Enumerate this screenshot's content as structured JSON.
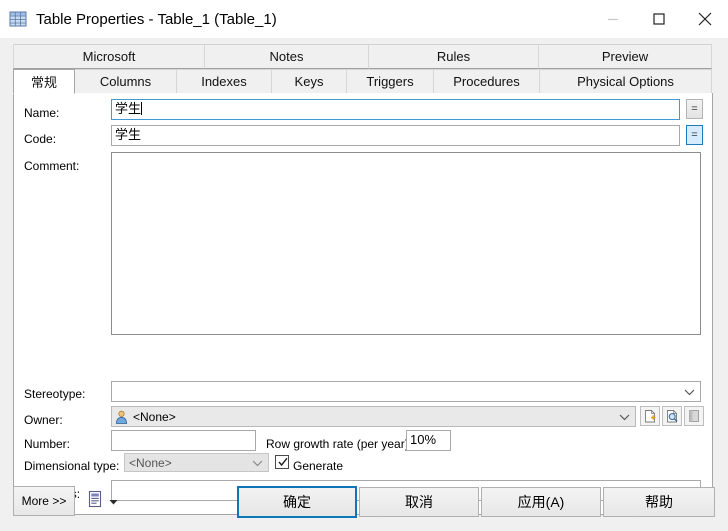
{
  "window": {
    "title": "Table Properties - Table_1 (Table_1)",
    "icon": "table-grid-icon",
    "minimize_label": "Minimize",
    "maximize_label": "Maximize",
    "close_label": "Close"
  },
  "tabs": {
    "row1": [
      {
        "label": "Microsoft",
        "active": false
      },
      {
        "label": "Notes",
        "active": false
      },
      {
        "label": "Rules",
        "active": false
      },
      {
        "label": "Preview",
        "active": false
      }
    ],
    "row2": [
      {
        "label": "常规",
        "active": true
      },
      {
        "label": "Columns",
        "active": false
      },
      {
        "label": "Indexes",
        "active": false
      },
      {
        "label": "Keys",
        "active": false
      },
      {
        "label": "Triggers",
        "active": false
      },
      {
        "label": "Procedures",
        "active": false
      },
      {
        "label": "Physical Options",
        "active": false
      }
    ]
  },
  "form": {
    "name_label": "Name:",
    "name_value": "学生",
    "name_equals_button": "=",
    "code_label": "Code:",
    "code_value": "学生",
    "code_equals_button": "=",
    "comment_label": "Comment:",
    "comment_value": "",
    "stereotype_label": "Stereotype:",
    "stereotype_value": "",
    "owner_label": "Owner:",
    "owner_value": "<None>",
    "number_label": "Number:",
    "number_value": "",
    "row_growth_label": "Row growth rate (per year):",
    "row_growth_value": "10%",
    "dimensional_label": "Dimensional type:",
    "dimensional_value": "<None>",
    "generate_label": "Generate",
    "generate_checked": true,
    "keywords_label": "Keywords:",
    "keywords_value": ""
  },
  "owner_tools": [
    {
      "name": "create-owner-icon",
      "tooltip": "Create"
    },
    {
      "name": "properties-owner-icon",
      "tooltip": "Properties"
    },
    {
      "name": "delete-owner-icon",
      "tooltip": "Delete"
    }
  ],
  "footer": {
    "more_label": "More >>",
    "report_icon": "report-icon",
    "report_dropdown_icon": "chevron-down-icon",
    "ok_label": "确定",
    "cancel_label": "取消",
    "apply_label": "应用(A)",
    "help_label": "帮助"
  },
  "colors": {
    "focus_blue": "#3e9bd4",
    "default_button_border": "#0f74b8",
    "dialog_bg": "#f0f0f0",
    "panel_bg": "#ffffff"
  }
}
